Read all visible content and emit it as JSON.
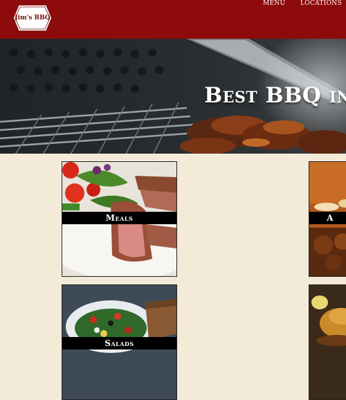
{
  "header": {
    "logo_text": "Jim's BBQ",
    "nav": [
      {
        "label": "MENU"
      },
      {
        "label": "LOCATIONS"
      }
    ],
    "bg_color": "#8e0b0b"
  },
  "hero": {
    "title": "Best BBQ in"
  },
  "categories": [
    {
      "label": "Meals"
    },
    {
      "label": "A"
    },
    {
      "label": "Salads"
    },
    {
      "label": ""
    }
  ]
}
